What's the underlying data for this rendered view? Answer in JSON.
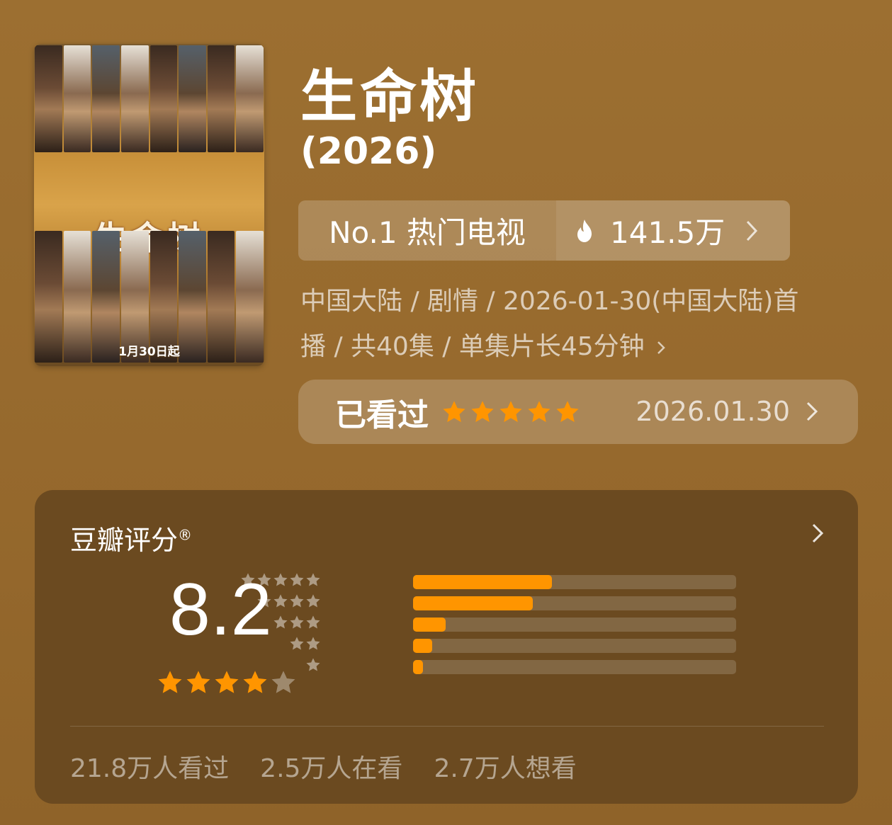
{
  "poster": {
    "title_text": "生命树",
    "date_text": "1月30日起"
  },
  "title": "生命树",
  "year": "(2026)",
  "rank": {
    "label": "No.1 热门电视",
    "heat": "141.5万"
  },
  "meta": {
    "line1": "中国大陆 / 剧情 / 2026-01-30(中国大陆)首",
    "line2": "播 / 共40集 / 单集片长45分钟"
  },
  "watched": {
    "label": "已看过",
    "user_stars": 5,
    "date": "2026.01.30"
  },
  "rating": {
    "header": "豆瓣评分",
    "registered_mark": "®",
    "score": "8.2",
    "stars": 4,
    "distribution": [
      {
        "stars": 5,
        "fraction": 0.43
      },
      {
        "stars": 4,
        "fraction": 0.37
      },
      {
        "stars": 3,
        "fraction": 0.1
      },
      {
        "stars": 2,
        "fraction": 0.06
      },
      {
        "stars": 1,
        "fraction": 0.03
      }
    ]
  },
  "stats": {
    "watched": "21.8万人看过",
    "watching": "2.5万人在看",
    "want": "2.7万人想看"
  },
  "colors": {
    "accent_orange": "#ff9500",
    "background": "#9a6d30",
    "card": "#6b4a20"
  },
  "icons": {
    "heat": "fire-icon",
    "arrow": "chevron-right-icon",
    "star": "star-icon"
  }
}
